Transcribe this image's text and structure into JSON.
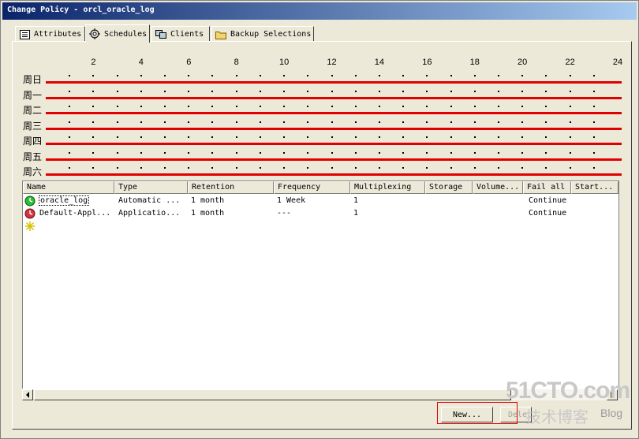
{
  "window": {
    "title": "Change Policy - orcl_oracle_log"
  },
  "tabs": [
    {
      "label": "Attributes",
      "icon": "list-icon"
    },
    {
      "label": "Schedules",
      "icon": "calendar-gear-icon",
      "active": true
    },
    {
      "label": "Clients",
      "icon": "computers-icon"
    },
    {
      "label": "Backup Selections",
      "icon": "folder-icon"
    }
  ],
  "schedule_grid": {
    "hours": [
      "2",
      "4",
      "6",
      "8",
      "10",
      "12",
      "14",
      "16",
      "18",
      "20",
      "22",
      "24"
    ],
    "days": [
      "周日",
      "周一",
      "周二",
      "周三",
      "周四",
      "周五",
      "周六"
    ]
  },
  "table": {
    "columns": [
      "Name",
      "Type",
      "Retention",
      "Frequency",
      "Multiplexing",
      "Storage",
      "Volume...",
      "Fail all",
      "Start..."
    ],
    "rows": [
      {
        "icon": "schedule-green-icon",
        "name": "oracle_log",
        "type": "Automatic ...",
        "retention": "1 month",
        "frequency": "1 Week",
        "multiplexing": "1",
        "storage": "",
        "volume": "",
        "fail_all": "Continue",
        "start": ""
      },
      {
        "icon": "schedule-red-icon",
        "name": "Default-Appl...",
        "type": "Applicatio...",
        "retention": "1 month",
        "frequency": "---",
        "multiplexing": "1",
        "storage": "",
        "volume": "",
        "fail_all": "Continue",
        "start": ""
      }
    ],
    "new_row_icon": "new-star-icon"
  },
  "buttons": {
    "new": "New...",
    "delete": "Dele..."
  },
  "watermark": {
    "line1": "51CTO.com",
    "line2": "技术博客",
    "line3": "Blog"
  },
  "colors": {
    "schedule_bar": "#e00000",
    "title_bar": "#0a246a"
  }
}
